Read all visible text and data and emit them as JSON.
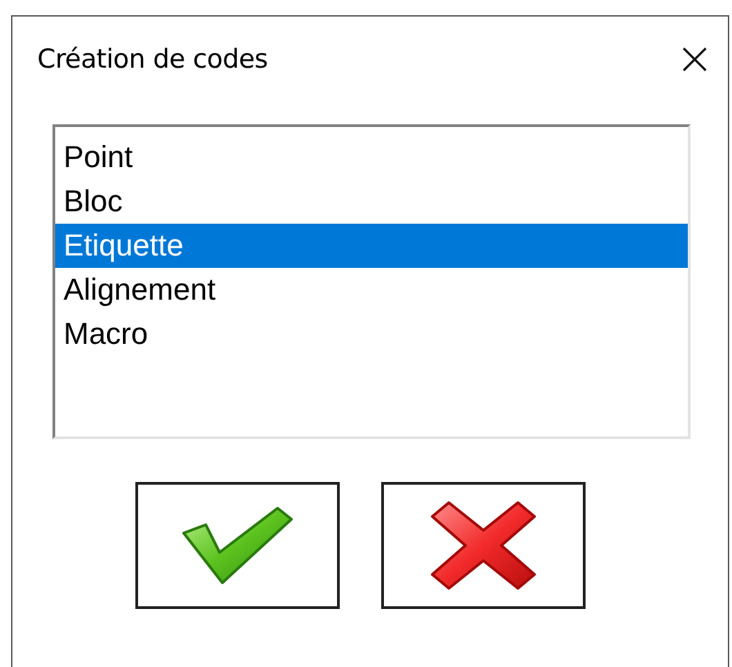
{
  "window": {
    "title": "Création de codes"
  },
  "list": {
    "items": [
      {
        "label": "Point",
        "selected": false
      },
      {
        "label": "Bloc",
        "selected": false
      },
      {
        "label": "Etiquette",
        "selected": true
      },
      {
        "label": "Alignement",
        "selected": false
      },
      {
        "label": "Macro",
        "selected": false
      }
    ]
  },
  "buttons": [
    {
      "kind": "ok"
    },
    {
      "kind": "cancel"
    }
  ]
}
